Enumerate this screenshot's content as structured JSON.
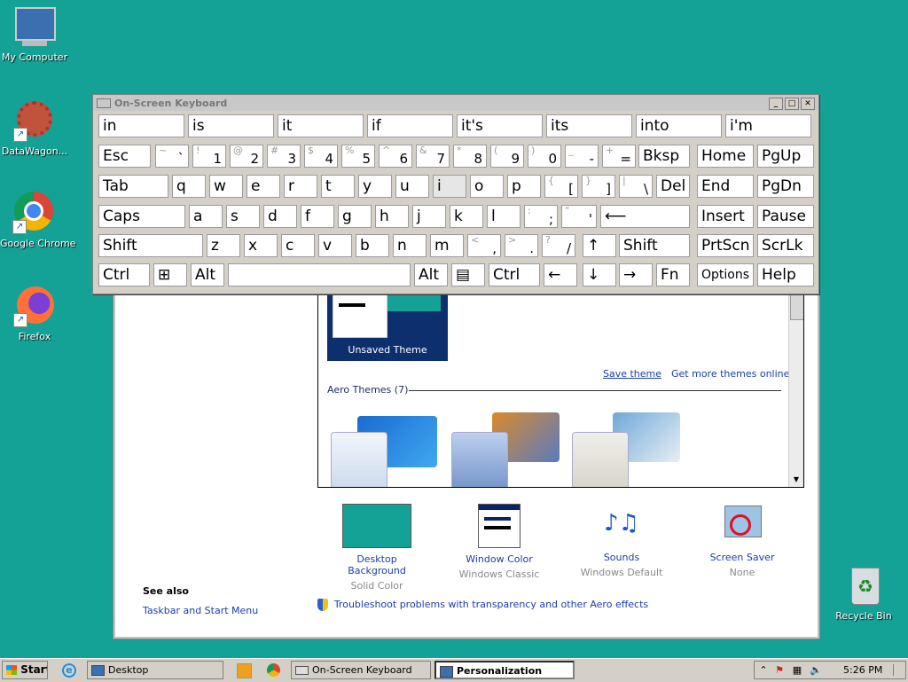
{
  "desktop": {
    "icons": [
      {
        "label": "My Computer"
      },
      {
        "label": "DataWagon..."
      },
      {
        "label": "Google Chrome"
      },
      {
        "label": "Firefox"
      },
      {
        "label": "Recycle Bin"
      }
    ],
    "background_color": "#13a295"
  },
  "osk": {
    "title": "On-Screen Keyboard",
    "suggestions": [
      "in",
      "is",
      "it",
      "if",
      "it's",
      "its",
      "into",
      "i'm"
    ],
    "rows": {
      "r1": [
        {
          "main": "Esc"
        },
        {
          "top": "~",
          "bot": "`"
        },
        {
          "top": "!",
          "bot": "1"
        },
        {
          "top": "@",
          "bot": "2"
        },
        {
          "top": "#",
          "bot": "3"
        },
        {
          "top": "$",
          "bot": "4"
        },
        {
          "top": "%",
          "bot": "5"
        },
        {
          "top": "^",
          "bot": "6"
        },
        {
          "top": "&",
          "bot": "7"
        },
        {
          "top": "*",
          "bot": "8"
        },
        {
          "top": "(",
          "bot": "9"
        },
        {
          "top": ")",
          "bot": "0"
        },
        {
          "top": "_",
          "bot": "-"
        },
        {
          "top": "+",
          "bot": "="
        },
        {
          "main": "Bksp"
        },
        {
          "main": "Home"
        },
        {
          "main": "PgUp"
        }
      ],
      "r2": [
        {
          "main": "Tab"
        },
        {
          "main": "q"
        },
        {
          "main": "w"
        },
        {
          "main": "e"
        },
        {
          "main": "r"
        },
        {
          "main": "t"
        },
        {
          "main": "y"
        },
        {
          "main": "u"
        },
        {
          "main": "i"
        },
        {
          "main": "o"
        },
        {
          "main": "p"
        },
        {
          "top": "{",
          "bot": "["
        },
        {
          "top": "}",
          "bot": "]"
        },
        {
          "top": "|",
          "bot": "\\"
        },
        {
          "main": "Del"
        },
        {
          "main": "End"
        },
        {
          "main": "PgDn"
        }
      ],
      "r3": [
        {
          "main": "Caps"
        },
        {
          "main": "a"
        },
        {
          "main": "s"
        },
        {
          "main": "d"
        },
        {
          "main": "f"
        },
        {
          "main": "g"
        },
        {
          "main": "h"
        },
        {
          "main": "j"
        },
        {
          "main": "k"
        },
        {
          "main": "l"
        },
        {
          "top": ":",
          "bot": ";"
        },
        {
          "top": "\"",
          "bot": "'"
        },
        {
          "main": "⟵"
        },
        {
          "main": "Insert"
        },
        {
          "main": "Pause"
        }
      ],
      "r4": [
        {
          "main": "Shift"
        },
        {
          "main": "z"
        },
        {
          "main": "x"
        },
        {
          "main": "c"
        },
        {
          "main": "v"
        },
        {
          "main": "b"
        },
        {
          "main": "n"
        },
        {
          "main": "m"
        },
        {
          "top": "<",
          "bot": ","
        },
        {
          "top": ">",
          "bot": "."
        },
        {
          "top": "?",
          "bot": "/"
        },
        {
          "main": "↑"
        },
        {
          "main": "Shift"
        },
        {
          "main": "PrtScn"
        },
        {
          "main": "ScrLk"
        }
      ],
      "r5": [
        {
          "main": "Ctrl"
        },
        {
          "main": "⊞"
        },
        {
          "main": "Alt"
        },
        {
          "main": ""
        },
        {
          "main": "Alt"
        },
        {
          "main": "▤"
        },
        {
          "main": "Ctrl"
        },
        {
          "main": "←"
        },
        {
          "main": "↓"
        },
        {
          "main": "→"
        },
        {
          "main": "Fn"
        },
        {
          "main": "Options"
        },
        {
          "main": "Help"
        }
      ]
    }
  },
  "personalization": {
    "unsaved_theme": "Unsaved Theme",
    "save_theme": "Save theme",
    "get_more": "Get more themes online",
    "aero_heading": "Aero Themes (7)",
    "bottom": [
      {
        "label": "Desktop Background",
        "sub": "Solid Color"
      },
      {
        "label": "Window Color",
        "sub": "Windows Classic"
      },
      {
        "label": "Sounds",
        "sub": "Windows Default"
      },
      {
        "label": "Screen Saver",
        "sub": "None"
      }
    ],
    "see_also": "See also",
    "taskbar_link": "Taskbar and Start Menu",
    "troubleshoot": "Troubleshoot problems with transparency and other Aero effects"
  },
  "taskbar": {
    "start": "Start",
    "items": [
      "Desktop",
      "On-Screen Keyboard",
      "Personalization"
    ],
    "clock": "5:26 PM"
  }
}
